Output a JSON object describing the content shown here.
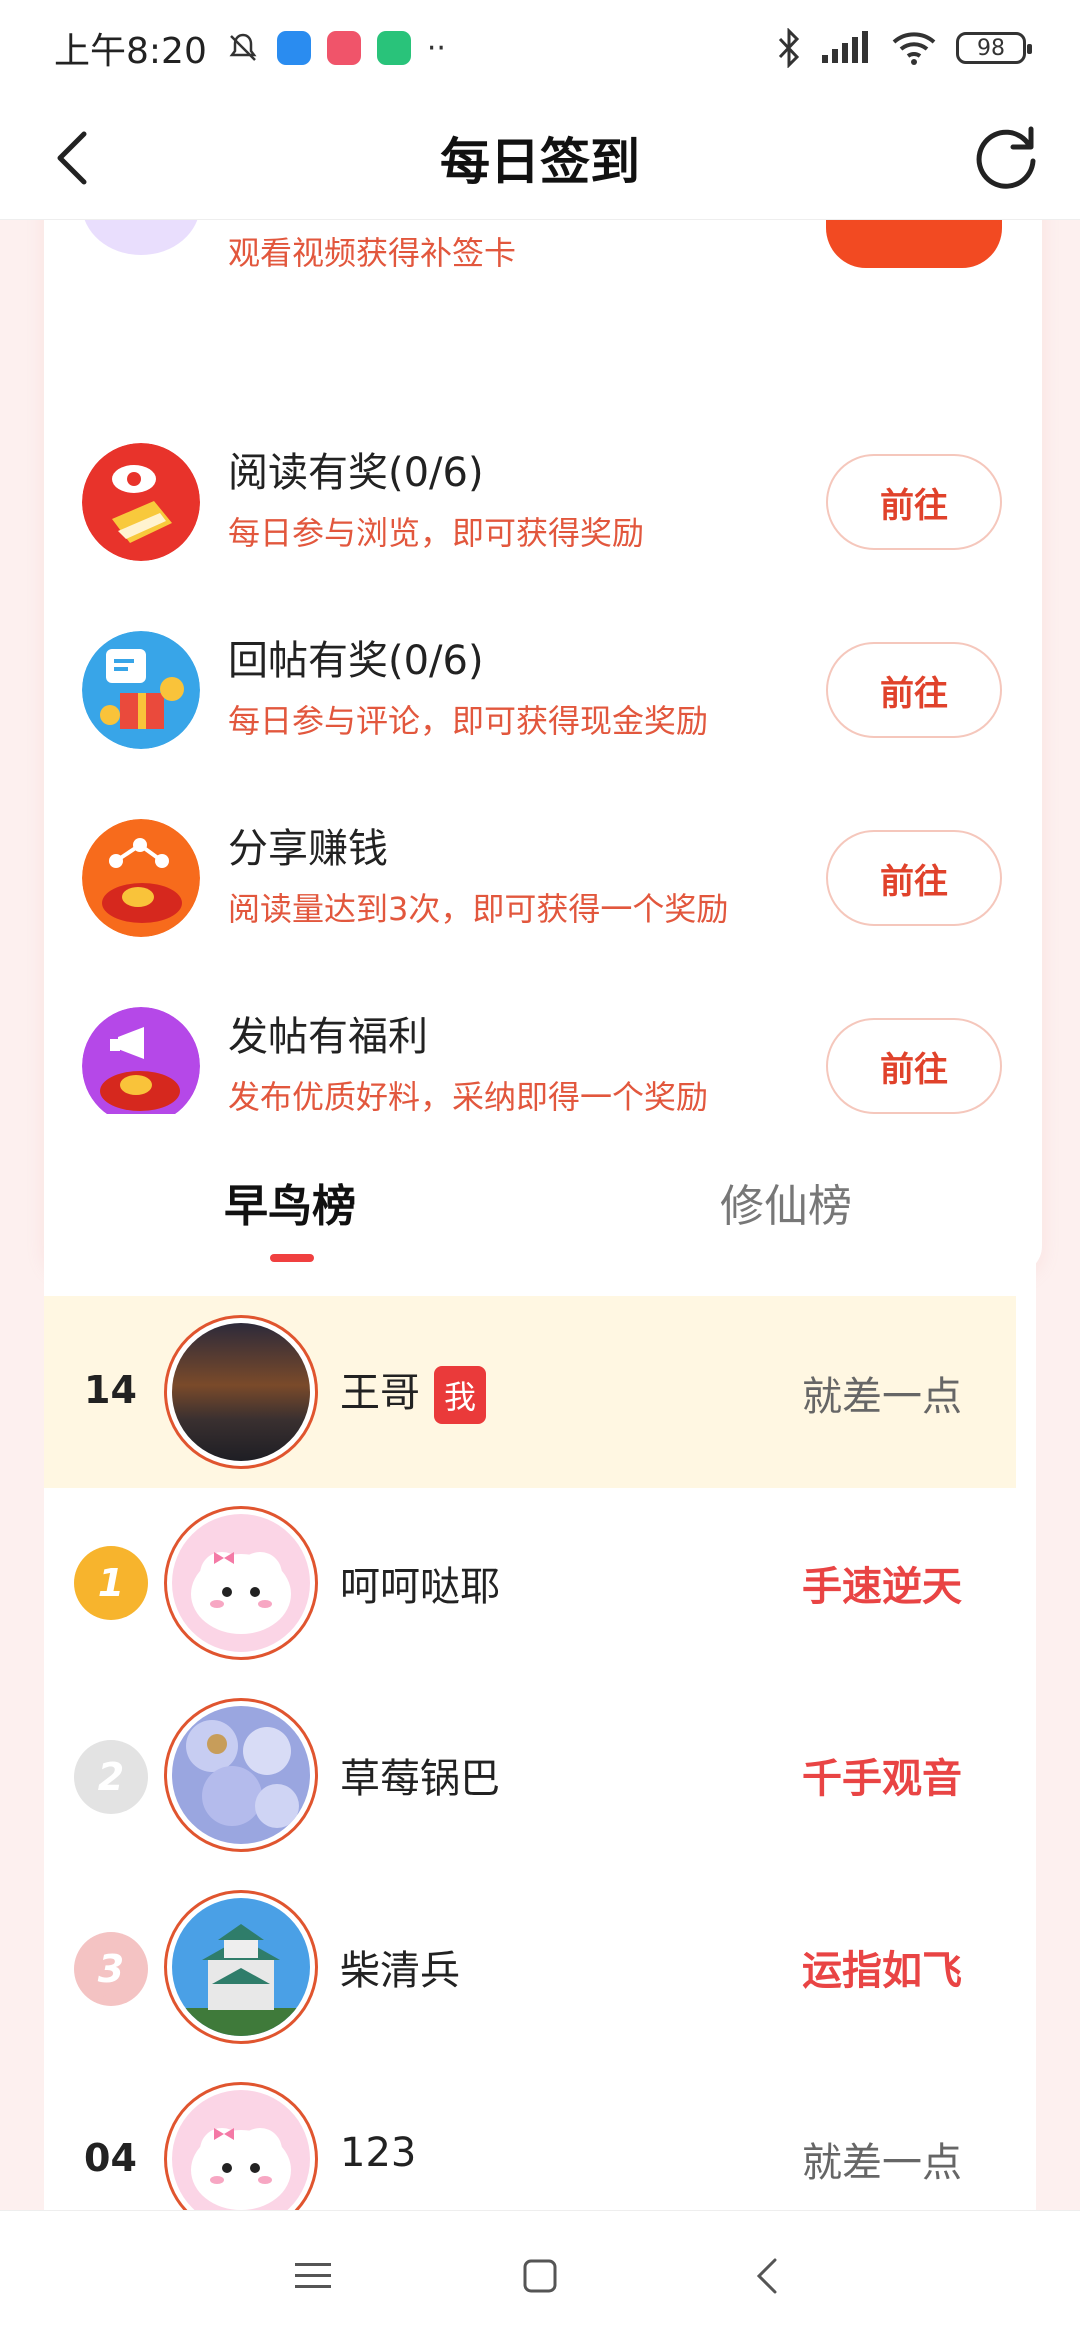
{
  "status_bar": {
    "time": "上午8:20",
    "battery": "98"
  },
  "header": {
    "title": "每日签到"
  },
  "tasks": [
    {
      "title": "",
      "desc": "观看视频获得补签卡",
      "button": ""
    },
    {
      "title": "阅读有奖(0/6)",
      "desc": "每日参与浏览，即可获得奖励",
      "button": "前往"
    },
    {
      "title": "回帖有奖(0/6)",
      "desc": "每日参与评论，即可获得现金奖励",
      "button": "前往"
    },
    {
      "title": "分享赚钱",
      "desc": "阅读量达到3次，即可获得一个奖励",
      "button": "前往"
    },
    {
      "title": "发帖有福利",
      "desc": "发布优质好料，采纳即得一个奖励",
      "button": "前往"
    }
  ],
  "leaderboard": {
    "tabs": [
      "早鸟榜",
      "修仙榜"
    ],
    "active_tab": "早鸟榜",
    "me": {
      "rank": "14",
      "name": "王哥",
      "badge": "我",
      "status": "就差一点"
    },
    "rows": [
      {
        "rank": "1",
        "name": "呵呵哒耶",
        "status": "手速逆天"
      },
      {
        "rank": "2",
        "name": "草莓锅巴",
        "status": "千手观音"
      },
      {
        "rank": "3",
        "name": "柴清兵",
        "status": "运指如飞"
      },
      {
        "rank": "04",
        "name": "123",
        "status": "就差一点"
      }
    ]
  },
  "colors": {
    "accent": "#e94444",
    "desc_orange": "#e2573d",
    "me_row_bg": "#fff7e2",
    "page_bg": "#fdf0ef"
  }
}
